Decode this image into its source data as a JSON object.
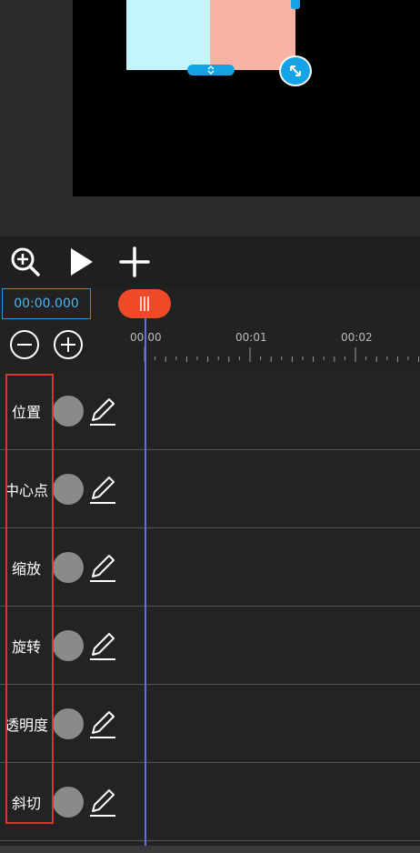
{
  "toolbar": {
    "zoom_icon": "zoom-in-icon",
    "play_icon": "play-icon",
    "add_icon": "plus-icon"
  },
  "timeline": {
    "timecode": "00:00.000",
    "ruler_labels": [
      "00:00",
      "00:01",
      "00:02"
    ]
  },
  "tracks": [
    {
      "label": "位置"
    },
    {
      "label": "中心点"
    },
    {
      "label": "缩放"
    },
    {
      "label": "旋转"
    },
    {
      "label": "透明度"
    },
    {
      "label": "斜切"
    }
  ],
  "colors": {
    "accent_blue": "#12a4e6",
    "playhead_knob": "#ee4a2a",
    "playhead_line": "#5b76d6",
    "highlight_border": "#d9352b",
    "clip_left": "#c4f5fb",
    "clip_right": "#f9b3a4"
  }
}
